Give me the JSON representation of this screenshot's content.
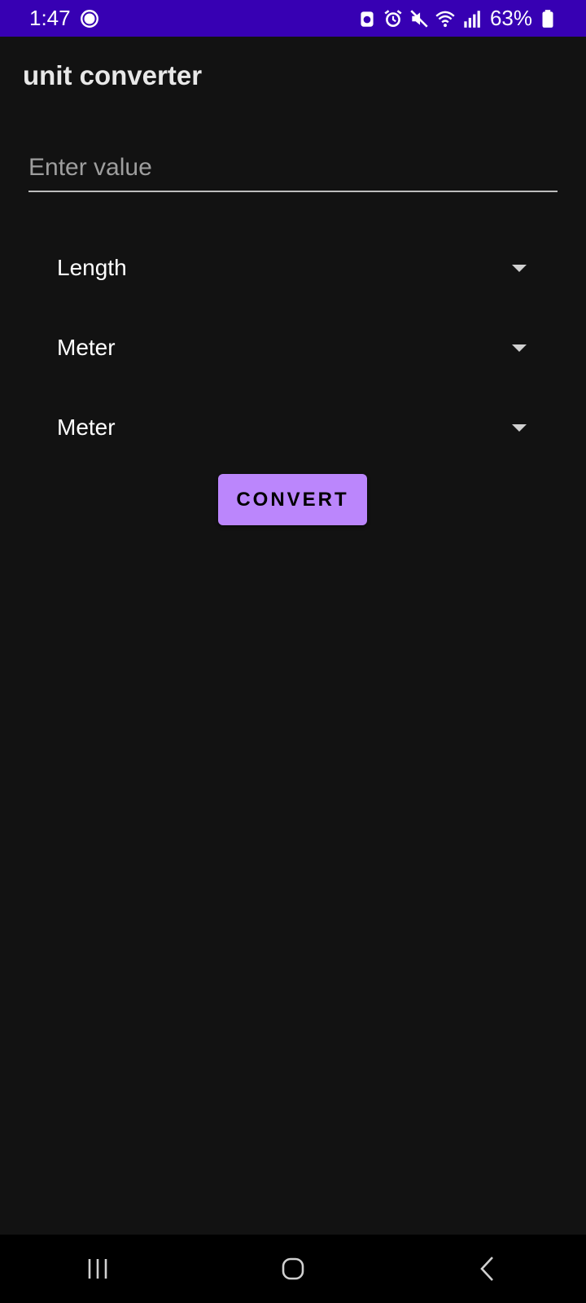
{
  "status_bar": {
    "time": "1:47",
    "battery": "63%",
    "icons": [
      "signal-messenger-icon",
      "dnd-alarm-icon",
      "alarm-icon",
      "mute-icon",
      "wifi-icon",
      "cell-signal-icon",
      "battery-icon"
    ],
    "background": "#3700b3"
  },
  "app": {
    "title": "unit converter"
  },
  "input": {
    "placeholder": "Enter value",
    "value": ""
  },
  "spinners": {
    "category": "Length",
    "from_unit": "Meter",
    "to_unit": "Meter"
  },
  "button": {
    "label": "CONVERT",
    "color": "#bb86fc"
  },
  "nav_bar": {
    "buttons": [
      "recents-icon",
      "home-icon",
      "back-icon"
    ]
  }
}
